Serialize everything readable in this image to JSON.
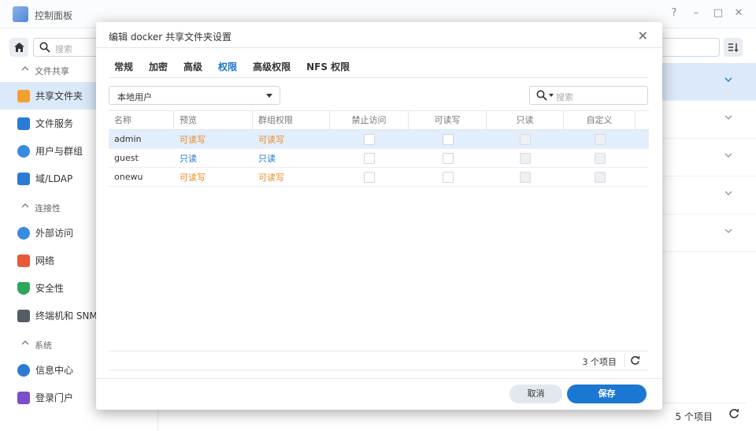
{
  "window": {
    "title": "控制面板",
    "help": "?",
    "minimize": "–",
    "maximize": "□",
    "close": "✕"
  },
  "sidebar": {
    "search_placeholder": "搜索",
    "sections": [
      {
        "label": "文件共享"
      },
      {
        "label": "连接性"
      },
      {
        "label": "系统"
      }
    ],
    "items": [
      {
        "label": "共享文件夹",
        "color": "#f0a030"
      },
      {
        "label": "文件服务",
        "color": "#2b7bd6"
      },
      {
        "label": "用户与群组",
        "color": "#3a8be0"
      },
      {
        "label": "域/LDAP",
        "color": "#2b7bd6"
      },
      {
        "label": "外部访问",
        "color": "#3a8be0"
      },
      {
        "label": "网络",
        "color": "#e65a3a"
      },
      {
        "label": "安全性",
        "color": "#2ea65a"
      },
      {
        "label": "终端机和 SNMP",
        "color": "#555c66"
      },
      {
        "label": "信息中心",
        "color": "#2b7bd6"
      },
      {
        "label": "登录门户",
        "color": "#7b4fc9"
      }
    ]
  },
  "main": {
    "count_label": "5 个项目"
  },
  "modal": {
    "title": "编辑 docker 共享文件夹设置",
    "close": "✕",
    "tabs": [
      {
        "label": "常规",
        "active": false
      },
      {
        "label": "加密",
        "active": false
      },
      {
        "label": "高级",
        "active": false
      },
      {
        "label": "权限",
        "active": true
      },
      {
        "label": "高级权限",
        "active": false
      },
      {
        "label": "NFS 权限",
        "active": false
      }
    ],
    "user_type_select": "本地用户",
    "search_placeholder": "搜索",
    "columns": [
      "名称",
      "预览",
      "群组权限",
      "禁止访问",
      "可读写",
      "只读",
      "自定义"
    ],
    "rows": [
      {
        "name": "admin",
        "preview": "可读写",
        "group_perm": "可读写",
        "preview_color": "orange",
        "group_color": "orange",
        "selected": true
      },
      {
        "name": "guest",
        "preview": "只读",
        "group_perm": "只读",
        "preview_color": "blue",
        "group_color": "blue",
        "selected": false
      },
      {
        "name": "onewu",
        "preview": "可读写",
        "group_perm": "可读写",
        "preview_color": "orange",
        "group_color": "orange",
        "selected": false
      }
    ],
    "count_label": "3 个项目",
    "cancel_label": "取消",
    "save_label": "保存"
  },
  "colors": {
    "accent": "#1a77d2",
    "orange_text": "#ec8a24",
    "selected_row": "#dbe9fa"
  }
}
